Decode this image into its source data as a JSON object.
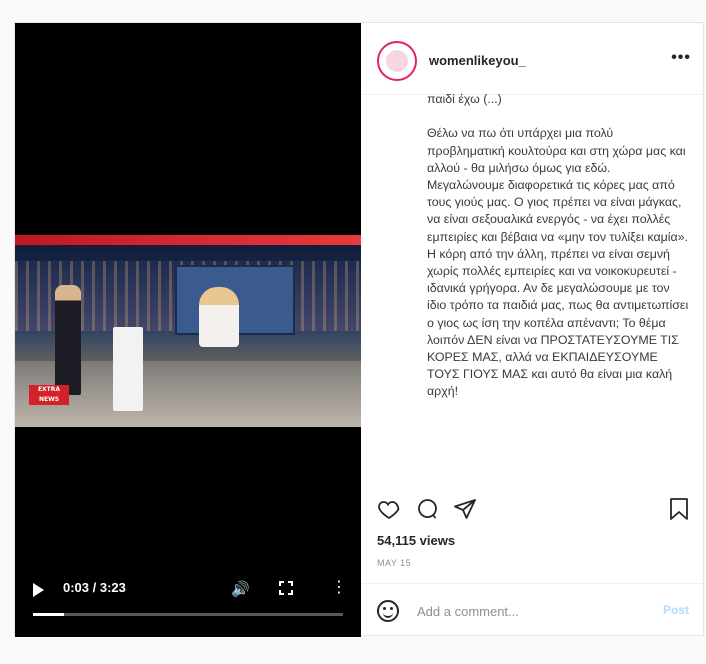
{
  "video": {
    "current_time": "0:03",
    "duration": "3:23",
    "time_display": "0:03 / 3:23",
    "progress_percent": 10,
    "channel_logo_text": "EXTRA NEWS"
  },
  "post": {
    "username": "womenlikeyou_",
    "more_label": "•••",
    "caption": "παιδί έχω (...)\n\nΘέλω να πω ότι υπάρχει μια πολύ προβληματική κουλτούρα και στη χώρα μας και αλλού - θα μιλήσω όμως για εδώ.\nΜεγαλώνουμε διαφορετικά τις κόρες μας από τους γιούς μας. Ο γιος πρέπει να είναι μάγκας, να είναι σεξουαλικά ενεργός - να έχει πολλές εμπειρίες και βέβαια να «μην τον τυλίξει καμία». Η κόρη από την άλλη, πρέπει να είναι σεμνή χωρίς πολλές εμπειρίες και να νοικοκυρευτεί - ιδανικά γρήγορα. Αν δε μεγαλώσουμε με τον ίδιο τρόπο τα παιδιά μας, πως θα αντιμετωπίσει ο γιος ως ίση την κοπέλα απέναντι; Το θέμα λοιπόν ΔΕΝ είναι να ΠΡΟΣΤΑΤΕΥΣΟΥΜΕ ΤΙΣ ΚΟΡΕΣ ΜΑΣ, αλλά να ΕΚΠΑΙΔΕΥΣΟΥΜΕ ΤΟΥΣ ΓΙΟΥΣ ΜΑΣ και αυτό θα είναι μια καλή αρχή!",
    "views": "54,115 views",
    "date": "MAY 15"
  },
  "comment_box": {
    "placeholder": "Add a comment...",
    "post_label": "Post"
  },
  "icons": {
    "like": "heart-icon",
    "comment": "comment-icon",
    "share": "share-icon",
    "save": "bookmark-icon",
    "emoji": "emoji-icon",
    "play": "play-icon",
    "volume": "volume-icon",
    "fullscreen": "fullscreen-icon",
    "video_more": "more-vertical-icon"
  },
  "colors": {
    "avatar_ring": "#e0245e",
    "post_button_disabled": "#b3dbff",
    "video_background": "#000000"
  }
}
